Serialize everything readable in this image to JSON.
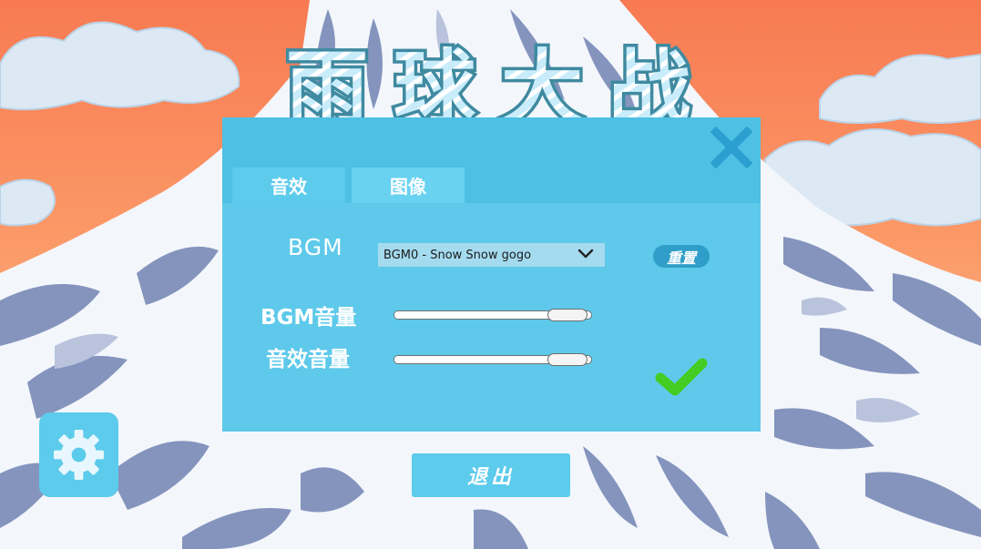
{
  "title": "雨球大战",
  "tabs": [
    {
      "label": "音效"
    },
    {
      "label": "图像"
    }
  ],
  "audio": {
    "bgm_label": "BGM",
    "bgm_selected": "BGM0 - Snow Snow gogo",
    "reset_label": "重置",
    "bgm_volume_label": "BGM音量",
    "sfx_volume_label": "音效音量",
    "bgm_volume": 0.88,
    "sfx_volume": 0.88
  },
  "exit_label": "退出",
  "icons": {
    "close": "close-icon",
    "confirm": "checkmark-icon",
    "settings": "gear-icon",
    "dropdown": "chevron-down-icon"
  },
  "colors": {
    "panel": "#4ec0e4",
    "panel_inner": "#5ec9ea",
    "accent": "#5ccbec",
    "confirm": "#44cc22",
    "close": "#2a9fd0"
  }
}
